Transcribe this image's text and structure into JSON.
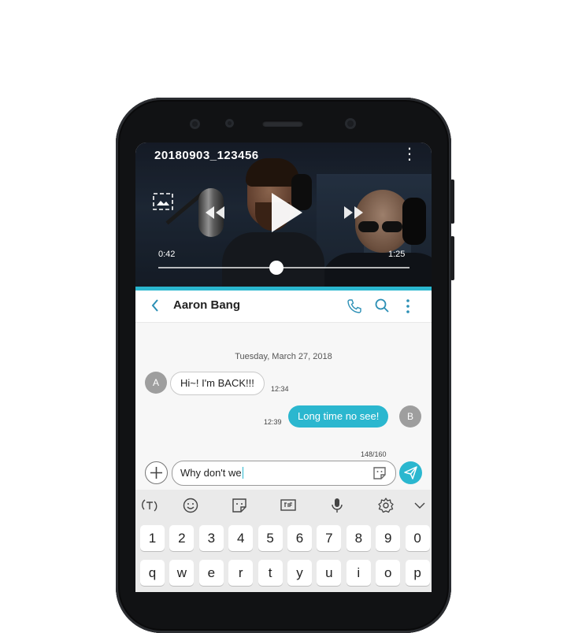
{
  "video": {
    "title": "20180903_123456",
    "current_time": "0:42",
    "duration": "1:25",
    "progress": 0.47
  },
  "chat": {
    "contact_name": "Aaron Bang",
    "date": "Tuesday, March 27, 2018",
    "messages": [
      {
        "direction": "incoming",
        "avatar": "A",
        "text": "Hi~! I'm BACK!!!",
        "time": "12:34"
      },
      {
        "direction": "outgoing",
        "avatar": "B",
        "text": "Long time no see!",
        "time": "12:39"
      }
    ],
    "char_count": "148/160",
    "input_value": "Why don't we"
  },
  "keyboard": {
    "toolbar_icons": [
      "text-scan-icon",
      "emoji-icon",
      "sticker-icon",
      "gif-icon",
      "mic-icon",
      "settings-icon",
      "collapse-chevron-icon"
    ],
    "number_row": [
      "1",
      "2",
      "3",
      "4",
      "5",
      "6",
      "7",
      "8",
      "9",
      "0"
    ],
    "letter_row": [
      "q",
      "w",
      "e",
      "r",
      "t",
      "y",
      "u",
      "i",
      "o",
      "p"
    ]
  },
  "colors": {
    "accent": "#2bb7cf",
    "phone_body": "#111214"
  }
}
